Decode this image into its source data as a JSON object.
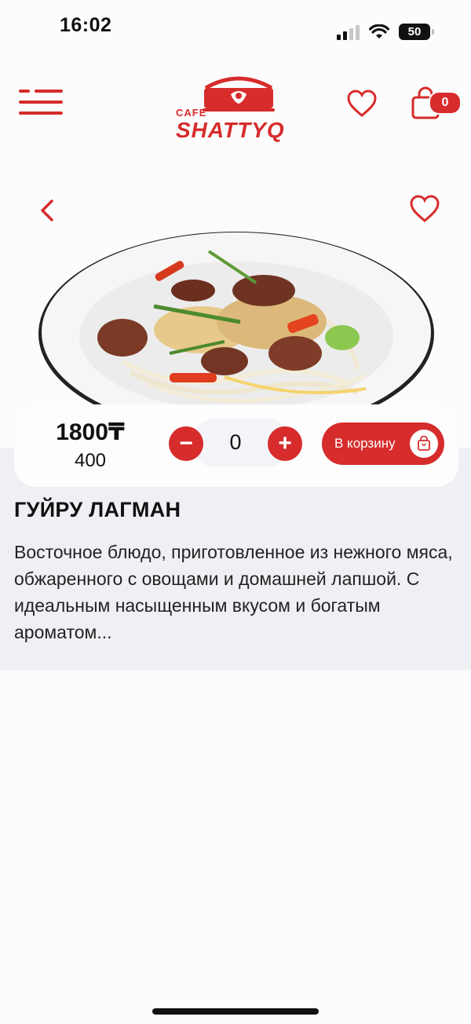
{
  "status_bar": {
    "time": "16:02",
    "battery": "50"
  },
  "header": {
    "logo_small": "CAFE",
    "logo_name": "SHATTYQ",
    "cart_count": "0"
  },
  "product": {
    "price": "1800₸",
    "weight": "400",
    "quantity": "0",
    "add_to_cart_label": "В корзину",
    "title": "ГУЙРУ ЛАГМАН",
    "description": "Восточное блюдо, приготовленное из нежного мяса, обжаренного с овощами и домашней лапшой. С идеальным насыщенным вкусом и богатым ароматом..."
  },
  "colors": {
    "accent": "#d72c2c",
    "section_bg": "#eff0f4"
  },
  "icons": [
    "menu-icon",
    "heart-icon",
    "cart-icon",
    "back-chevron-icon",
    "bag-icon"
  ]
}
